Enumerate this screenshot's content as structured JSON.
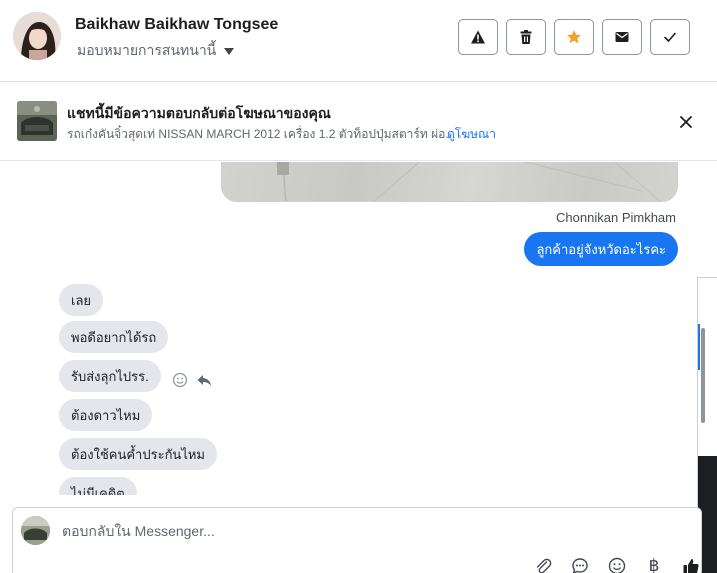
{
  "header": {
    "contact_name": "Baikhaw Baikhaw Tongsee",
    "assign_label": "มอบหมายการสนทนานี้",
    "actions": [
      {
        "icon": "warning-icon",
        "label": "Report"
      },
      {
        "icon": "trash-icon",
        "label": "Delete"
      },
      {
        "icon": "star-icon",
        "label": "Star",
        "color": "#f0a331"
      },
      {
        "icon": "mail-icon",
        "label": "Mark unread"
      },
      {
        "icon": "check-icon",
        "label": "Done"
      }
    ]
  },
  "ad_banner": {
    "title": "แชทนี้มีข้อความตอบกลับต่อโฆษณาของคุณ",
    "description": "รถเก๋งคันจิ๋วสุดเท่ NISSAN MARCH 2012 เครื่อง 1.2 ตัวท็อปปุ่มสตาร์ท ผ่อ...",
    "link_label": "ดูโฆษณา"
  },
  "messages": {
    "outgoing_sender": "Chonnikan Pimkham",
    "outgoing": [
      {
        "text": "ลูกค้าอยู่จังหวัดอะไรคะ"
      }
    ],
    "incoming": [
      {
        "text": "เลย"
      },
      {
        "text": "พอดีอยากได้รถ"
      },
      {
        "text": "รับส่งลุกไปรร."
      },
      {
        "text": "ต้องดาวไหม"
      },
      {
        "text": "ต้องใช้คนค้ำประกันไหม"
      },
      {
        "text": "ไม่มีเคดิต"
      }
    ]
  },
  "composer": {
    "placeholder": "ตอบกลับใน Messenger...",
    "value": "",
    "tools": [
      "attachment-icon",
      "saved-reply-icon",
      "emoji-icon",
      "baht-icon",
      "like-icon"
    ]
  },
  "colors": {
    "accent": "#1876f2",
    "bubble_in": "#e4e6eb",
    "star": "#f0a331"
  }
}
